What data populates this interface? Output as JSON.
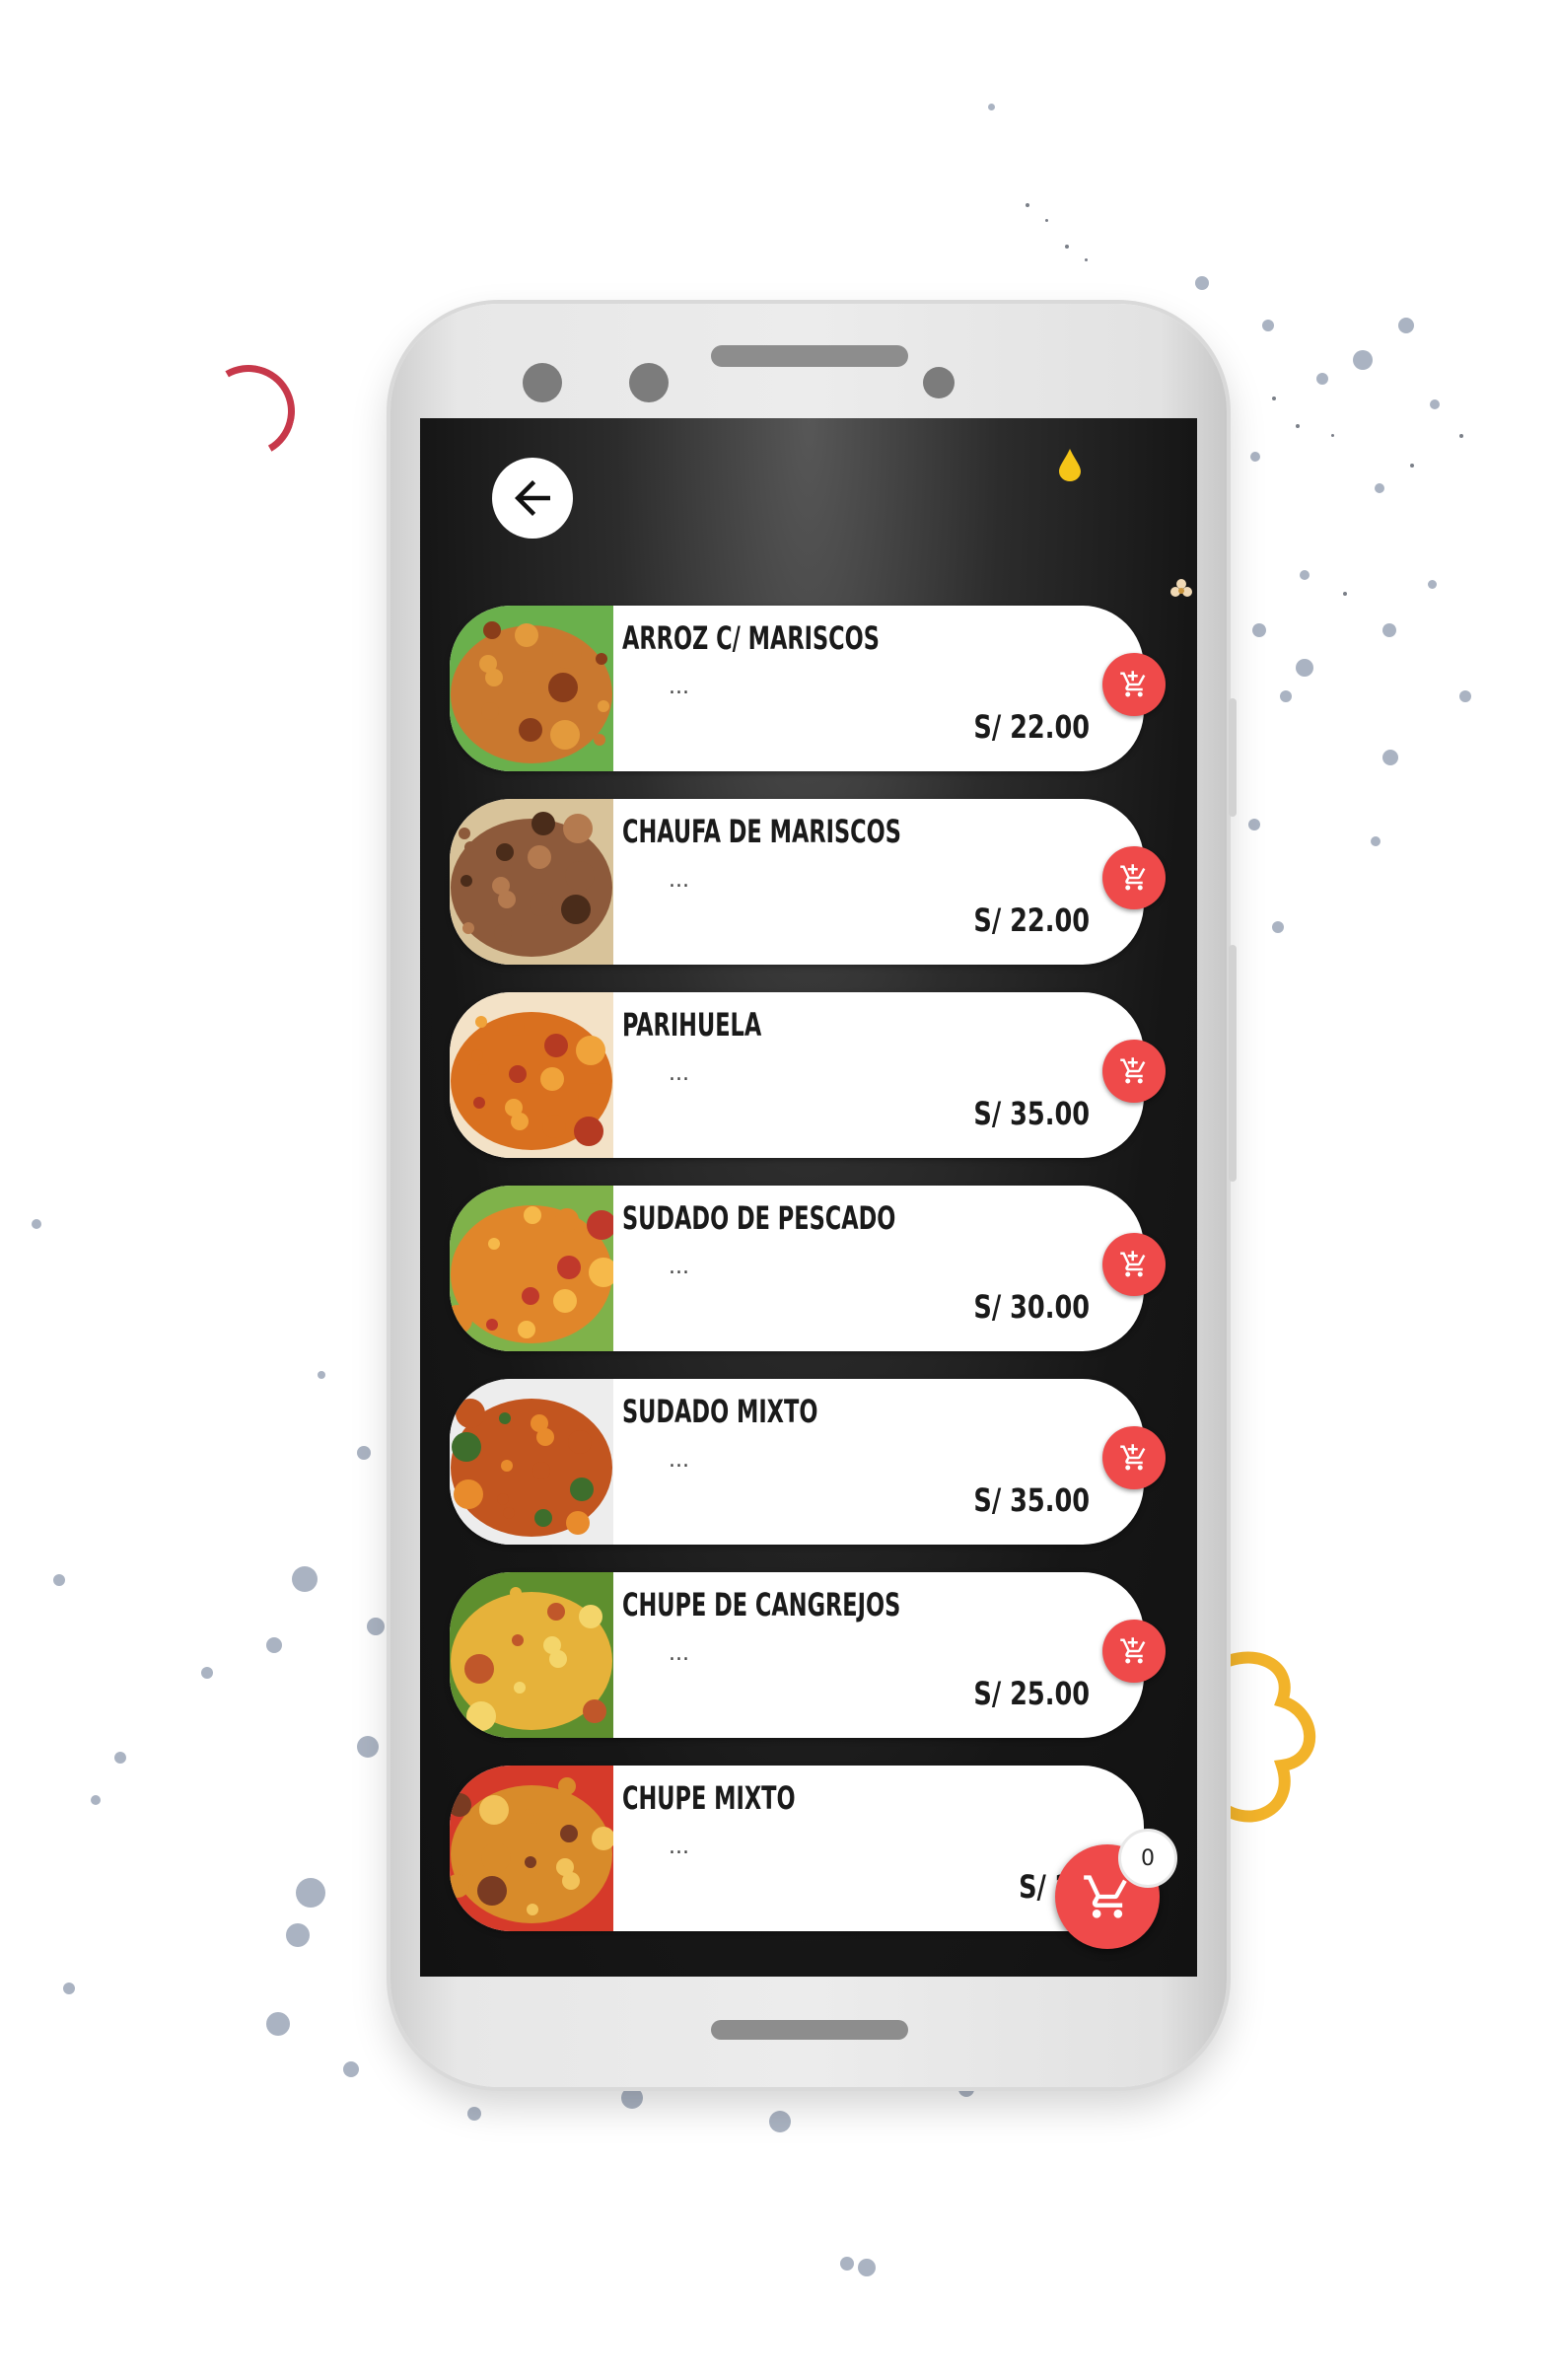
{
  "header": {
    "back_icon": "arrow-left-icon"
  },
  "menu": {
    "items": [
      {
        "name": "ARROZ C/ MARISCOS",
        "desc": "...",
        "price": "S/ 22.00",
        "image": "rice-seafood"
      },
      {
        "name": "CHAUFA DE MARISCOS",
        "desc": "...",
        "price": "S/ 22.00",
        "image": "fried-rice-seafood"
      },
      {
        "name": "PARIHUELA",
        "desc": "...",
        "price": "S/ 35.00",
        "image": "parihuela-soup"
      },
      {
        "name": "SUDADO DE PESCADO",
        "desc": "...",
        "price": "S/ 30.00",
        "image": "fish-stew"
      },
      {
        "name": "SUDADO MIXTO",
        "desc": "...",
        "price": "S/ 35.00",
        "image": "mixed-stew"
      },
      {
        "name": "CHUPE DE CANGREJOS",
        "desc": "...",
        "price": "S/ 25.00",
        "image": "crab-chowder"
      },
      {
        "name": "CHUPE MIXTO",
        "desc": "...",
        "price": "S/ 25",
        "image": "mixed-chowder"
      }
    ]
  },
  "cart": {
    "count": "0",
    "icon": "shopping-cart-icon"
  },
  "colors": {
    "accent": "#ef4a4a",
    "card": "#ffffff",
    "screen_bg": "#161616"
  }
}
